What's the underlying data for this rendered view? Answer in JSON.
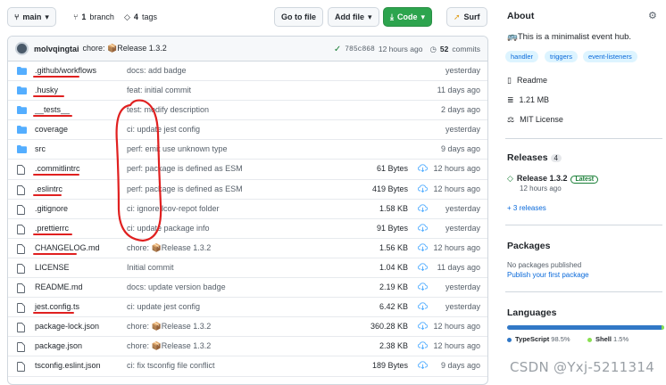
{
  "toolbar": {
    "branch": "main",
    "branches_count": "1",
    "branches_label": "branch",
    "tags_count": "4",
    "tags_label": "tags",
    "goto_file": "Go to file",
    "add_file": "Add file",
    "code": "Code",
    "surf": "Surf"
  },
  "commit": {
    "author": "molvqingtai",
    "message": "chore: 📦Release 1.3.2",
    "sha": "785c868",
    "time": "12 hours ago",
    "count": "52",
    "count_label": "commits"
  },
  "files": [
    {
      "type": "dir",
      "name": ".github/workflows",
      "message": "docs: add badge",
      "size": "",
      "time": "yesterday"
    },
    {
      "type": "dir",
      "name": ".husky",
      "message": "feat: initial commit",
      "size": "",
      "time": "11 days ago"
    },
    {
      "type": "dir",
      "name": "__tests__",
      "message": "test: modify description",
      "size": "",
      "time": "2 days ago"
    },
    {
      "type": "dir",
      "name": "coverage",
      "message": "ci: update jest config",
      "size": "",
      "time": "yesterday"
    },
    {
      "type": "dir",
      "name": "src",
      "message": "perf: emit use unknown type",
      "size": "",
      "time": "9 days ago"
    },
    {
      "type": "file",
      "name": ".commitlintrc",
      "message": "perf: package is defined as ESM",
      "size": "61 Bytes",
      "time": "12 hours ago"
    },
    {
      "type": "file",
      "name": ".eslintrc",
      "message": "perf: package is defined as ESM",
      "size": "419 Bytes",
      "time": "12 hours ago"
    },
    {
      "type": "file",
      "name": ".gitignore",
      "message": "ci: ignore lcov-repot folder",
      "size": "1.58 KB",
      "time": "yesterday"
    },
    {
      "type": "file",
      "name": ".prettierrc",
      "message": "ci: update package info",
      "size": "91 Bytes",
      "time": "yesterday"
    },
    {
      "type": "file",
      "name": "CHANGELOG.md",
      "message": "chore: 📦Release 1.3.2",
      "size": "1.56 KB",
      "time": "12 hours ago"
    },
    {
      "type": "file",
      "name": "LICENSE",
      "message": "Initial commit",
      "size": "1.04 KB",
      "time": "11 days ago"
    },
    {
      "type": "file",
      "name": "README.md",
      "message": "docs: update version badge",
      "size": "2.19 KB",
      "time": "yesterday"
    },
    {
      "type": "file",
      "name": "jest.config.ts",
      "message": "ci: update jest config",
      "size": "6.42 KB",
      "time": "yesterday"
    },
    {
      "type": "file",
      "name": "package-lock.json",
      "message": "chore: 📦Release 1.3.2",
      "size": "360.28 KB",
      "time": "12 hours ago"
    },
    {
      "type": "file",
      "name": "package.json",
      "message": "chore: 📦Release 1.3.2",
      "size": "2.38 KB",
      "time": "12 hours ago"
    },
    {
      "type": "file",
      "name": "tsconfig.eslint.json",
      "message": "ci: fix tsconfig file conflict",
      "size": "189 Bytes",
      "time": "9 days ago"
    }
  ],
  "sidebar": {
    "about_title": "About",
    "description": "🚌This is a minimalist event hub.",
    "topics": [
      "handler",
      "triggers",
      "event-listeners"
    ],
    "readme": "Readme",
    "size": "1.21 MB",
    "license": "MIT License",
    "releases_title": "Releases",
    "releases_count": "4",
    "release_name": "Release 1.3.2",
    "release_badge": "Latest",
    "release_time": "12 hours ago",
    "more_releases": "+ 3 releases",
    "packages_title": "Packages",
    "packages_none": "No packages published",
    "packages_link": "Publish your first package",
    "languages_title": "Languages",
    "languages": [
      {
        "name": "TypeScript",
        "percent": "98.5%",
        "color": "#3178c6"
      },
      {
        "name": "Shell",
        "percent": "1.5%",
        "color": "#89e051"
      }
    ]
  },
  "watermark": "CSDN @Yxj-5211314",
  "colors": {
    "folder": "#54aeff",
    "green_button": "#2da44e",
    "link": "#0969da",
    "annotation": "#e02020"
  }
}
